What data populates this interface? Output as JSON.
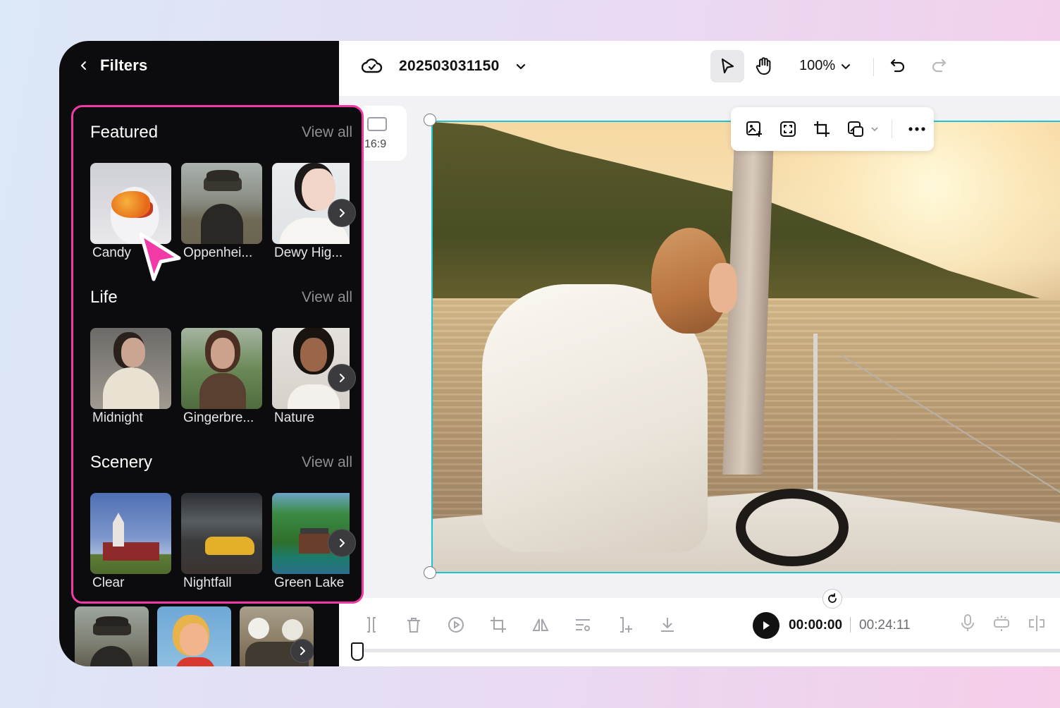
{
  "panel": {
    "title": "Filters",
    "sections": [
      {
        "title": "Featured",
        "view_all": "View all",
        "items": [
          {
            "label": "Candy",
            "image": "candy"
          },
          {
            "label": "Oppenhei...",
            "image": "oppen"
          },
          {
            "label": "Dewy Hig...",
            "image": "dewy"
          }
        ]
      },
      {
        "title": "Life",
        "view_all": "View all",
        "items": [
          {
            "label": "Midnight",
            "image": "midnight"
          },
          {
            "label": "Gingerbre...",
            "image": "ginger"
          },
          {
            "label": "Nature",
            "image": "nature"
          }
        ]
      },
      {
        "title": "Scenery",
        "view_all": "View all",
        "items": [
          {
            "label": "Clear",
            "image": "clear"
          },
          {
            "label": "Nightfall",
            "image": "night"
          },
          {
            "label": "Green Lake",
            "image": "green"
          }
        ]
      }
    ],
    "highlight_color": "#f23aa7"
  },
  "topbar": {
    "doc_name": "202503031150",
    "zoom": "100%"
  },
  "canvas": {
    "aspect_ratio": "16:9",
    "selection_color": "#1fc3d6"
  },
  "float_toolbar": {
    "icons": [
      "replace-image-icon",
      "fit-icon",
      "crop-icon",
      "mask-icon",
      "more-icon"
    ]
  },
  "timeline": {
    "current_time": "00:00:00",
    "total_time": "00:24:11",
    "tools": [
      "split-icon",
      "delete-icon",
      "speed-icon",
      "crop-icon",
      "flip-icon",
      "adjust-icon",
      "trim-icon",
      "download-icon"
    ],
    "right_tools": [
      "mic-icon",
      "ai-enhance-icon",
      "split-audio-icon"
    ]
  },
  "icons": {
    "back": "chevron-left-icon",
    "cloud": "cloud-icon",
    "select": "pointer-icon",
    "hand": "hand-icon",
    "undo": "undo-icon",
    "redo": "redo-icon",
    "next": "chevron-right-icon",
    "cursor": "mouse-cursor-icon"
  }
}
